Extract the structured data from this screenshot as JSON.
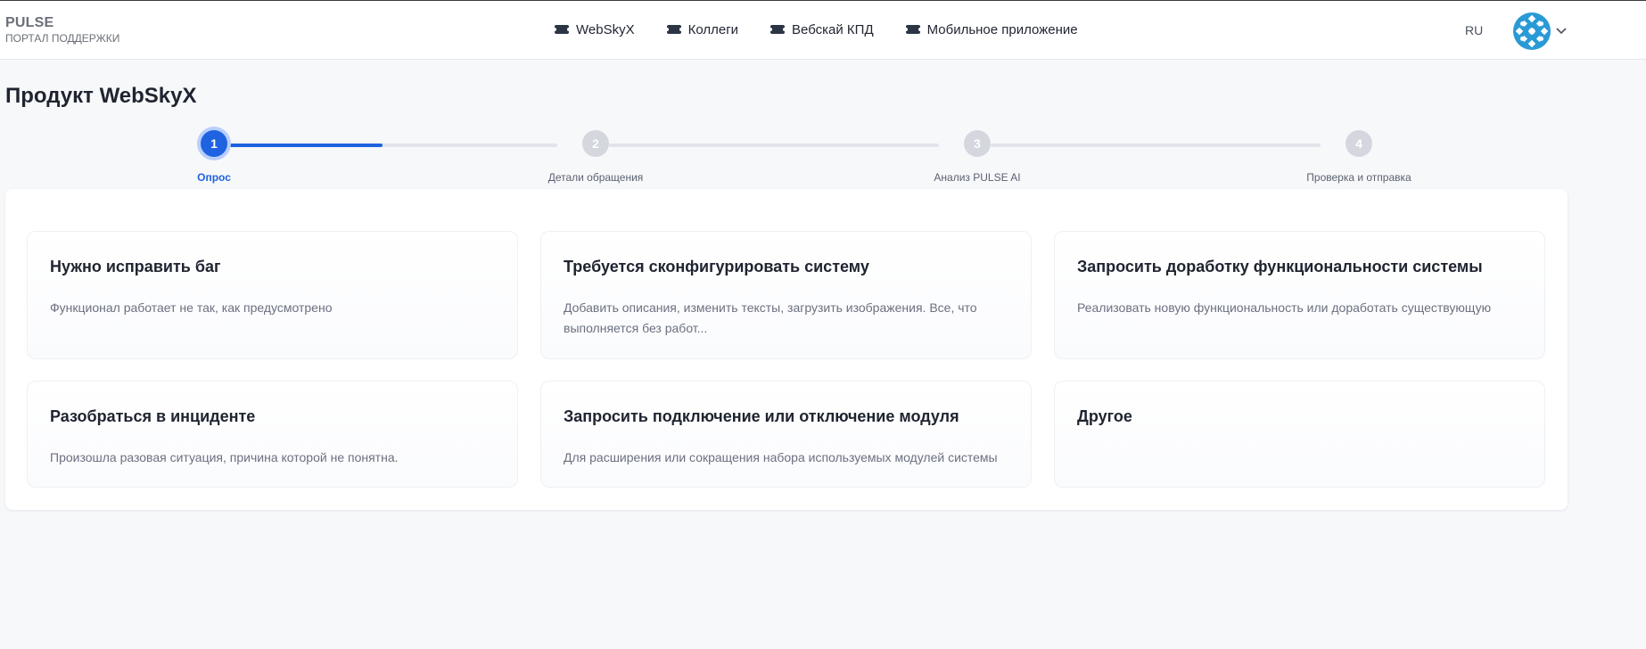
{
  "header": {
    "brand_name": "PULSE",
    "brand_sub": "ПОРТАЛ ПОДДЕРЖКИ",
    "nav": [
      {
        "label": "WebSkyX",
        "icon": "ticket-icon"
      },
      {
        "label": "Коллеги",
        "icon": "ticket-icon"
      },
      {
        "label": "Вебскай КПД",
        "icon": "ticket-icon"
      },
      {
        "label": "Мобильное приложение",
        "icon": "ticket-icon"
      }
    ],
    "language": "RU",
    "avatar_icon": "user-avatar",
    "dropdown_icon": "chevron-down-icon"
  },
  "page": {
    "title": "Продукт WebSkyX"
  },
  "stepper": {
    "current_step": 1,
    "progress_fraction_in_first_segment": 0.47,
    "steps": [
      {
        "number": "1",
        "label": "Опрос"
      },
      {
        "number": "2",
        "label": "Детали обращения"
      },
      {
        "number": "3",
        "label": "Анализ PULSE AI"
      },
      {
        "number": "4",
        "label": "Проверка и отправка"
      }
    ]
  },
  "options": [
    {
      "title": "Нужно исправить баг",
      "description": "Функционал работает не так, как предусмотрено"
    },
    {
      "title": "Требуется сконфигурировать систему",
      "description": "Добавить описания, изменить тексты, загрузить изображения. Все, что выполняется без работ..."
    },
    {
      "title": "Запросить доработку функциональности системы",
      "description": "Реализовать новую функциональность или доработать существующую"
    },
    {
      "title": "Разобраться в инциденте",
      "description": "Произошла разовая ситуация, причина которой не понятна."
    },
    {
      "title": "Запросить подключение или отключение модуля",
      "description": "Для расширения или сокращения набора используемых модулей системы"
    },
    {
      "title": "Другое",
      "description": ""
    }
  ],
  "colors": {
    "accent": "#1f63e0",
    "inactive_step": "#d4d7dd",
    "background": "#f7f8fa"
  }
}
